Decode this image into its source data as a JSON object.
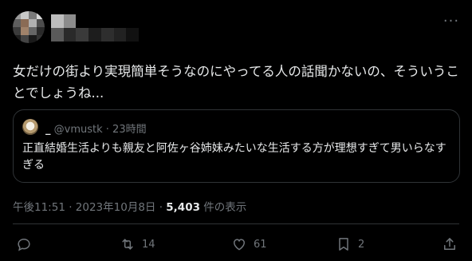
{
  "tweet": {
    "text": "女だけの街より実現簡単そうなのにやってる人の話聞かないの、そういうことでしょうね...",
    "timestamp": "午後11:51 · 2023年10月8日 · ",
    "views_count": "5,403",
    "views_label": " 件の表示"
  },
  "quote": {
    "name": "_",
    "handle": "@vmustk",
    "time": "23時間",
    "text": "正直結婚生活よりも親友と阿佐ヶ谷姉妹みたいな生活する方が理想すぎて男いらなすぎる"
  },
  "actions": {
    "reply_count": "",
    "retweet_count": "14",
    "like_count": "61",
    "bookmark_count": "2"
  },
  "icons": {
    "more": "more-icon",
    "reply": "reply-icon",
    "retweet": "retweet-icon",
    "like": "heart-icon",
    "bookmark": "bookmark-icon",
    "share": "share-icon"
  },
  "colors": {
    "background": "#000000",
    "text": "#e7e9ea",
    "muted": "#71767b",
    "border": "#2f3336"
  }
}
